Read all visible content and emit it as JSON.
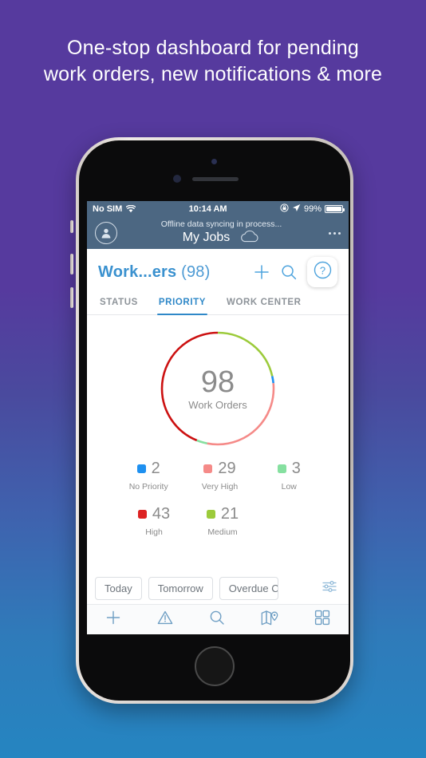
{
  "headline": {
    "line1": "One-stop dashboard for pending",
    "line2": "work orders, new notifications & more"
  },
  "theme": {
    "bg_top": "#563a9e",
    "bg_bottom": "#2585c1",
    "accent_blue": "#3a91cf",
    "navbar_bg": "#4c6782"
  },
  "status_bar": {
    "carrier": "No SIM",
    "wifi_icon": "wifi-icon",
    "time": "10:14 AM",
    "rotation_lock_icon": "rotation-lock-icon",
    "location_icon": "location-arrow-icon",
    "battery_percent": "99%",
    "battery_icon": "battery-icon"
  },
  "nav_bar": {
    "avatar_icon": "user-avatar-icon",
    "sync_status": "Offline data syncing in process...",
    "title": "My Jobs",
    "cloud_icon": "cloud-icon",
    "overflow_icon": "more-dots-icon"
  },
  "title_bar": {
    "title": "Work...ers",
    "count": "(98)",
    "add_icon": "plus-icon",
    "search_icon": "search-icon",
    "help_icon": "question-mark-icon"
  },
  "tabs": [
    {
      "label": "STATUS",
      "active": false
    },
    {
      "label": "PRIORITY",
      "active": true
    },
    {
      "label": "WORK CENTER",
      "active": false
    }
  ],
  "chart_data": {
    "type": "pie",
    "title": "98",
    "subtitle": "Work Orders",
    "center_value": "98",
    "center_label": "Work Orders",
    "total": 98,
    "categories": [
      "Medium",
      "No Priority",
      "Very High",
      "Low",
      "High"
    ],
    "values": [
      21,
      2,
      29,
      3,
      43
    ],
    "colors": [
      "#9ccb3b",
      "#1e90f0",
      "#f58a88",
      "#86e0a0",
      "#cc1111"
    ],
    "legend": "below-chart",
    "grid": false
  },
  "legend": {
    "row1": [
      {
        "value": "2",
        "name": "No Priority",
        "color": "#1e90f0"
      },
      {
        "value": "29",
        "name": "Very High",
        "color": "#f58a88"
      },
      {
        "value": "3",
        "name": "Low",
        "color": "#86e0a0"
      }
    ],
    "row2": [
      {
        "value": "43",
        "name": "High",
        "color": "#dd2222"
      },
      {
        "value": "21",
        "name": "Medium",
        "color": "#9ccb3b"
      }
    ]
  },
  "filters": {
    "chips": [
      "Today",
      "Tomorrow",
      "Overdue C"
    ],
    "filter_icon": "sliders-filter-icon"
  },
  "bottom_tabbar": [
    {
      "icon": "plus-icon",
      "name": "create"
    },
    {
      "icon": "warning-triangle-icon",
      "name": "alerts"
    },
    {
      "icon": "search-icon",
      "name": "search"
    },
    {
      "icon": "map-pin-icon",
      "name": "map"
    },
    {
      "icon": "grid-dashboard-icon",
      "name": "dashboard"
    }
  ]
}
